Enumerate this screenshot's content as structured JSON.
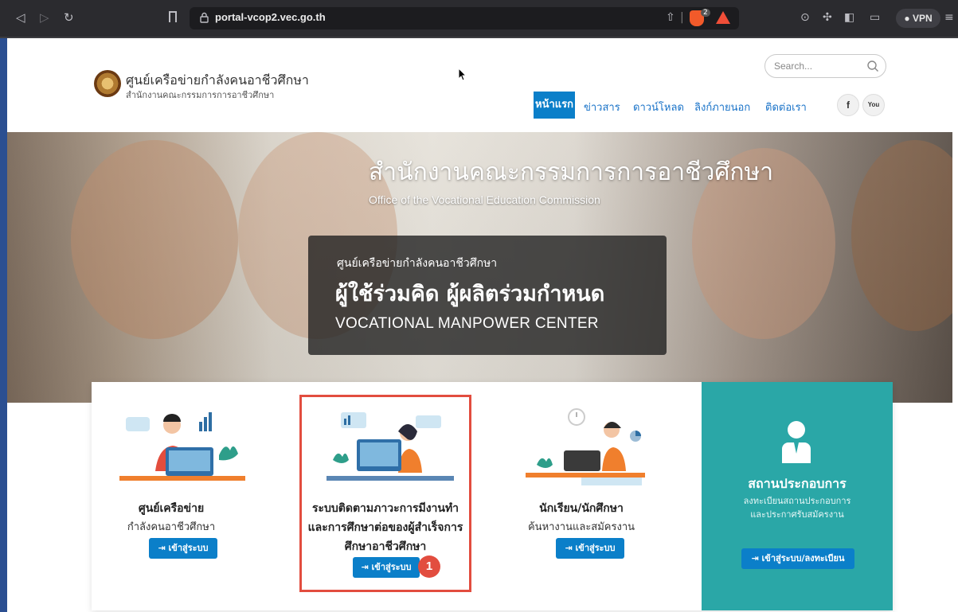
{
  "browser": {
    "url": "portal-vcop2.vec.go.th",
    "brave_count": "2",
    "vpn_label": "● VPN"
  },
  "header": {
    "org_title": "ศูนย์เครือข่ายกำลังคนอาชีวศึกษา",
    "org_subtitle": "สำนักงานคณะกรรมการการอาชีวศึกษา",
    "search_placeholder": "Search...",
    "menu": [
      "หน้าแรก",
      "ข่าวสาร",
      "ดาวน์โหลด",
      "ลิงก์ภายนอก",
      "ติดต่อเรา"
    ],
    "social": [
      "f",
      "You"
    ]
  },
  "hero": {
    "title_th": "สำนักงานคณะกรรมการการอาชีวศึกษา",
    "title_en": "Office of the Vocational Education Commission",
    "box_small": "ศูนย์เครือข่ายกำลังคนอาชีวศึกษา",
    "box_big": "ผู้ใช้ร่วมคิด ผู้ผลิตร่วมกำหนด",
    "box_en": "VOCATIONAL MANPOWER CENTER"
  },
  "cards": [
    {
      "title": "ศูนย์เครือข่าย",
      "lines": [
        "กำลังคนอาชีวศึกษา"
      ],
      "button": "⇥ เข้าสู่ระบบ"
    },
    {
      "title": "ระบบติดตามภาวะการมีงานทำ",
      "lines": [
        "และการศึกษาต่อของผู้สำเร็จการ",
        "ศึกษาอาชีวศึกษา"
      ],
      "button": "⇥ เข้าสู่ระบบ",
      "badge": "1"
    },
    {
      "title": "นักเรียน/นักศึกษา",
      "lines": [
        "ค้นหางานและสมัครงาน"
      ],
      "button": "⇥ เข้าสู่ระบบ"
    },
    {
      "title": "สถานประกอบการ",
      "lines": [
        "ลงทะเบียนสถานประกอบการ",
        "และประกาศรับสมัครงาน"
      ],
      "button": "⇥ เข้าสู่ระบบ/ลงทะเบียน"
    }
  ],
  "colors": {
    "primary": "#0b7fc9",
    "teal": "#2aa7a7",
    "highlight": "#e24d3f"
  }
}
